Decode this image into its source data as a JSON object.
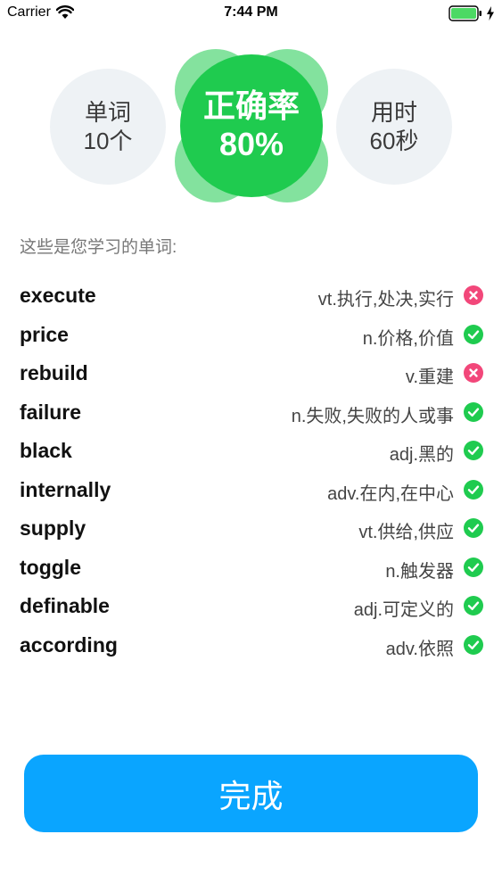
{
  "status_bar": {
    "carrier": "Carrier",
    "time": "7:44 PM",
    "battery_color": "#4cd964"
  },
  "stats": {
    "words_label": "单词",
    "words_value": "10个",
    "accuracy_label": "正确率",
    "accuracy_value": "80%",
    "time_label": "用时",
    "time_value": "60秒",
    "accent_green": "#1fcb4f"
  },
  "section_heading": "这些是您学习的单词:",
  "words": [
    {
      "word": "execute",
      "meaning": "vt.执行,处决,实行",
      "correct": false
    },
    {
      "word": "price",
      "meaning": "n.价格,价值",
      "correct": true
    },
    {
      "word": "rebuild",
      "meaning": "v.重建",
      "correct": false
    },
    {
      "word": "failure",
      "meaning": "n.失败,失败的人或事",
      "correct": true
    },
    {
      "word": "black",
      "meaning": "adj.黑的",
      "correct": true
    },
    {
      "word": "internally",
      "meaning": "adv.在内,在中心",
      "correct": true
    },
    {
      "word": "supply",
      "meaning": "vt.供给,供应",
      "correct": true
    },
    {
      "word": "toggle",
      "meaning": "n.触发器",
      "correct": true
    },
    {
      "word": "definable",
      "meaning": "adj.可定义的",
      "correct": true
    },
    {
      "word": "according",
      "meaning": "adv.依照",
      "correct": true
    }
  ],
  "icons": {
    "correct": "check-circle-icon",
    "wrong": "x-circle-icon",
    "correct_color": "#1fcb4f",
    "wrong_color": "#f2477a"
  },
  "done_button": {
    "label": "完成",
    "color": "#0aa5ff"
  }
}
